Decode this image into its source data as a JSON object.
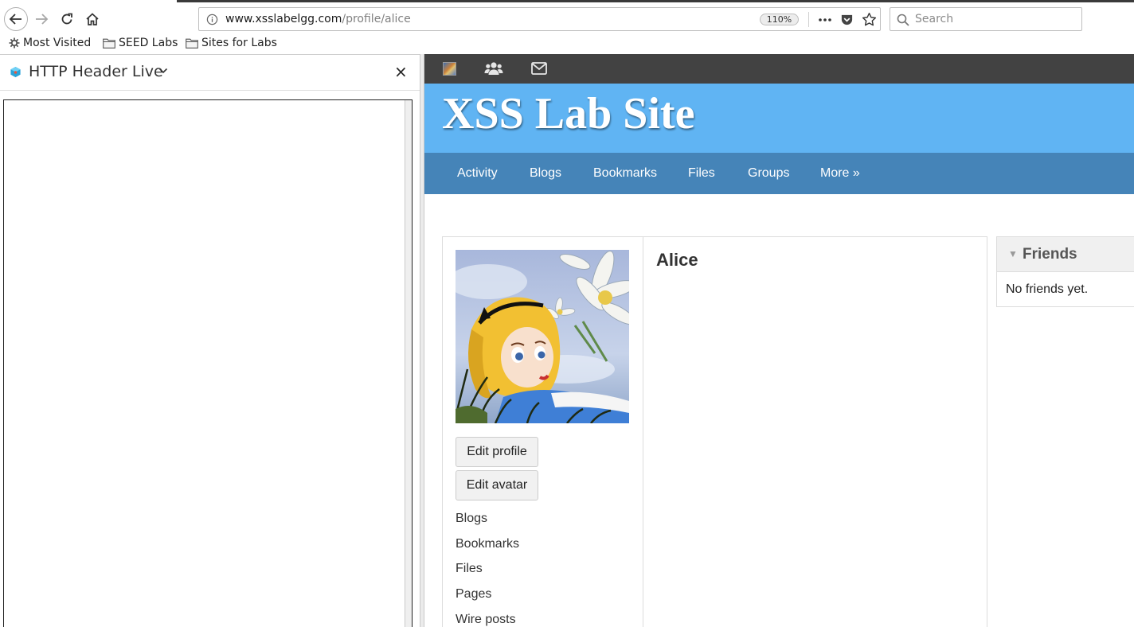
{
  "browser": {
    "url_host": "www.xsslabelgg.com",
    "url_path": "/profile/alice",
    "zoom": "110%",
    "search_placeholder": "Search"
  },
  "bookmarks": [
    {
      "label": "Most Visited",
      "icon": "gear-icon"
    },
    {
      "label": "SEED Labs",
      "icon": "folder-icon"
    },
    {
      "label": "Sites for Labs",
      "icon": "folder-icon"
    }
  ],
  "sidebar": {
    "title": "HTTP Header Live",
    "close_label": "×"
  },
  "site": {
    "title": "XSS Lab Site",
    "header_color": "#60b4f3",
    "menu_color": "#4584b8",
    "topbar_color": "#424242",
    "menu": [
      "Activity",
      "Blogs",
      "Bookmarks",
      "Files",
      "Groups",
      "More »"
    ]
  },
  "profile": {
    "name": "Alice",
    "edit_profile": "Edit profile",
    "edit_avatar": "Edit avatar",
    "links": [
      "Blogs",
      "Bookmarks",
      "Files",
      "Pages",
      "Wire posts"
    ]
  },
  "friends": {
    "title": "Friends",
    "caret": "▼",
    "empty_text": "No friends yet."
  }
}
